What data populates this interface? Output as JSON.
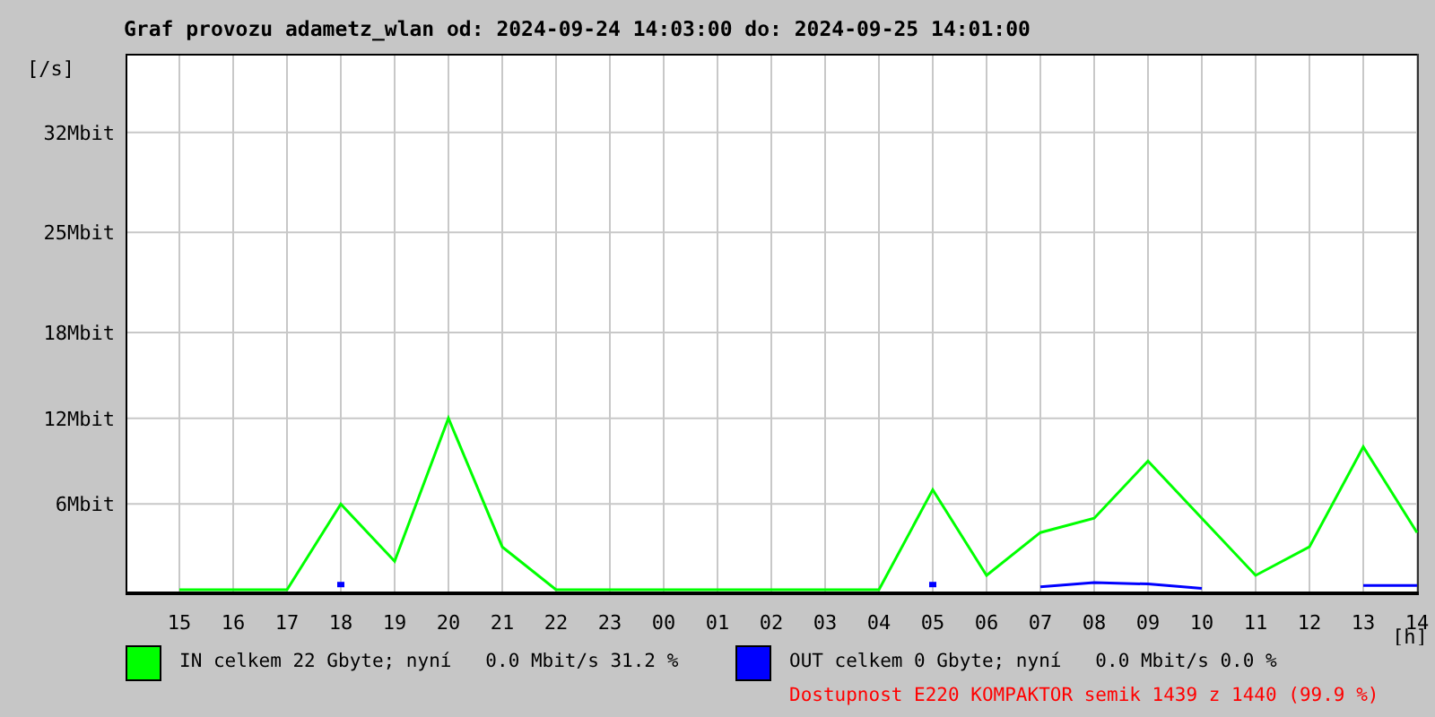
{
  "chart_data": {
    "type": "line",
    "title": "Graf provozu adametz_wlan od: 2024-09-24 14:03:00 do: 2024-09-25 14:01:00",
    "ylabel": "[/s]",
    "xlabel": "[h]",
    "grid": true,
    "categories": [
      "15",
      "16",
      "17",
      "18",
      "19",
      "20",
      "21",
      "22",
      "23",
      "00",
      "01",
      "02",
      "03",
      "04",
      "05",
      "06",
      "07",
      "08",
      "09",
      "10",
      "11",
      "12",
      "13",
      "14"
    ],
    "series": [
      {
        "name": "IN",
        "color": "#00ff00",
        "values": [
          0,
          0,
          0,
          6,
          2,
          12,
          3,
          0,
          0,
          0,
          0,
          0,
          0,
          0,
          7,
          1,
          4,
          5,
          9,
          5,
          1,
          3,
          10,
          4
        ]
      },
      {
        "name": "OUT",
        "color": "#0000ff",
        "values": [
          null,
          null,
          null,
          0.3,
          null,
          null,
          null,
          null,
          null,
          null,
          null,
          null,
          null,
          null,
          0.3,
          null,
          0.2,
          0.5,
          0.4,
          0.1,
          null,
          null,
          0.3,
          0.3
        ]
      }
    ],
    "ylim": [
      0,
      37.5
    ],
    "yticks": [
      {
        "value": 6,
        "label": "6Mbit"
      },
      {
        "value": 12,
        "label": "12Mbit"
      },
      {
        "value": 18,
        "label": "18Mbit"
      },
      {
        "value": 25,
        "label": "25Mbit"
      },
      {
        "value": 32,
        "label": "32Mbit"
      }
    ]
  },
  "legend": [
    {
      "label": "celkem 22 Gbyte; nyní   0.0 Mbit/s 31.2 %"
    },
    {
      "label": "celkem 0 Gbyte; nyní   0.0 Mbit/s 0.0 %"
    }
  ],
  "availability": "Dostupnost E220 KOMPAKTOR semik 1439 z 1440 (99.9 %)"
}
